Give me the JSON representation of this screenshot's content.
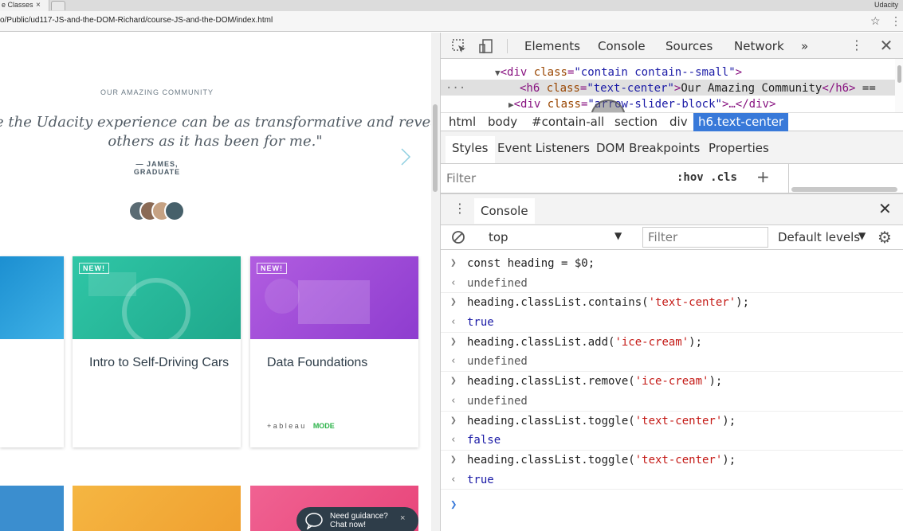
{
  "browser": {
    "tab_title": "e Classes",
    "tab_close": "×",
    "url": "o/Public/ud117-JS-and-the-DOM-Richard/course-JS-and-the-DOM/index.html",
    "profile_label": "Udacity"
  },
  "page": {
    "eyebrow": "OUR AMAZING COMMUNITY",
    "quote_line1": "e the Udacity experience can be as transformative and revealing for",
    "quote_line2": "others as it has been for me.\"",
    "attribution": "— JAMES, GRADUATE",
    "cards": [
      {
        "badge": "NEW!",
        "title": "Intro to Self-Driving Cars",
        "image_color": "#2fc6a6"
      },
      {
        "badge": "NEW!",
        "title": "Data Foundations",
        "image_color": "#a74bd8"
      }
    ],
    "partner_logos": {
      "tableau": "+ a b l e a u",
      "mode": "MODE"
    },
    "chat": {
      "line1": "Need guidance?",
      "line2": "Chat now!",
      "close": "×"
    },
    "colors": {
      "accent": "#02b3e4",
      "text_dark": "#2e3d49"
    }
  },
  "devtools": {
    "tabs": [
      "Elements",
      "Console",
      "Sources",
      "Network"
    ],
    "more_tabs": "»",
    "dom": {
      "line1_tag": "<div ",
      "line1_attr": "class",
      "line1_val": "\"contain contain--small\"",
      "line1_end": ">",
      "line2_open": "<h6 ",
      "line2_attr": "class",
      "line2_val": "\"text-center\"",
      "line2_text": "Our Amazing Community",
      "line2_close": "</h6>",
      "line2_suffix": " ==",
      "line3_open": "<div ",
      "line3_attr": "class",
      "line3_val": "\"arrow-slider-block\"",
      "line3_rest": ">…</div>"
    },
    "breadcrumbs": [
      "html",
      "body",
      "#contain-all",
      "section",
      "div",
      "h6.text-center"
    ],
    "style_tabs": [
      "Styles",
      "Event Listeners",
      "DOM Breakpoints",
      "Properties"
    ],
    "filter_placeholder": "Filter",
    "hov": ":hov",
    "cls": ".cls",
    "drawer_tab": "Console",
    "context": "top",
    "console_filter": "Filter",
    "levels": "Default levels",
    "console": [
      {
        "type": "input",
        "code": "const heading = $0;"
      },
      {
        "type": "output",
        "code": "undefined"
      },
      {
        "type": "input",
        "code": "heading.classList.contains('text-center');"
      },
      {
        "type": "output",
        "code": "true"
      },
      {
        "type": "input",
        "code": "heading.classList.add('ice-cream');"
      },
      {
        "type": "output",
        "code": "undefined"
      },
      {
        "type": "input",
        "code": "heading.classList.remove('ice-cream');"
      },
      {
        "type": "output",
        "code": "undefined"
      },
      {
        "type": "input",
        "code": "heading.classList.toggle('text-center');"
      },
      {
        "type": "output",
        "code": "false"
      },
      {
        "type": "input",
        "code": "heading.classList.toggle('text-center');"
      },
      {
        "type": "output",
        "code": "true"
      }
    ]
  }
}
